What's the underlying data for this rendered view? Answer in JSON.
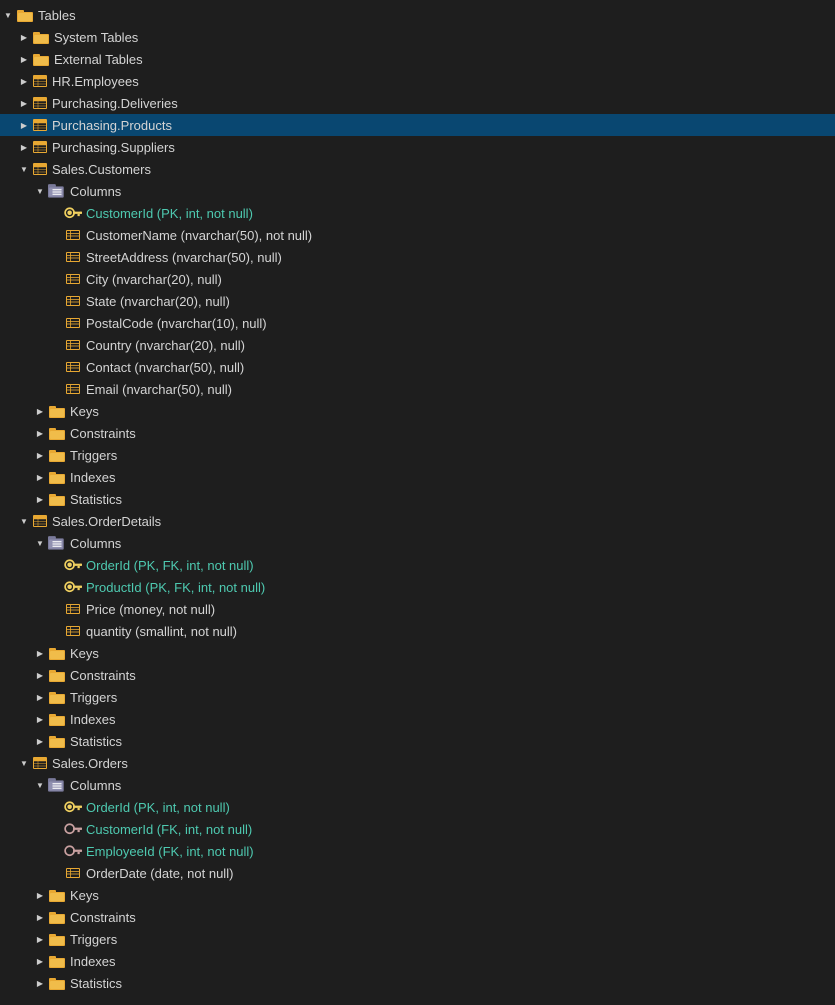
{
  "tree": {
    "items": [
      {
        "id": "tables",
        "label": "Tables",
        "level": 0,
        "toggle": "collapse",
        "icon": "folder",
        "selected": false
      },
      {
        "id": "system-tables",
        "label": "System Tables",
        "level": 1,
        "toggle": "expand",
        "icon": "folder",
        "selected": false
      },
      {
        "id": "external-tables",
        "label": "External Tables",
        "level": 1,
        "toggle": "expand",
        "icon": "folder",
        "selected": false
      },
      {
        "id": "hr-employees",
        "label": "HR.Employees",
        "level": 1,
        "toggle": "expand",
        "icon": "table",
        "selected": false
      },
      {
        "id": "purchasing-deliveries",
        "label": "Purchasing.Deliveries",
        "level": 1,
        "toggle": "expand",
        "icon": "table",
        "selected": false
      },
      {
        "id": "purchasing-products",
        "label": "Purchasing.Products",
        "level": 1,
        "toggle": "expand",
        "icon": "table",
        "selected": true
      },
      {
        "id": "purchasing-suppliers",
        "label": "Purchasing.Suppliers",
        "level": 1,
        "toggle": "expand",
        "icon": "table",
        "selected": false
      },
      {
        "id": "sales-customers",
        "label": "Sales.Customers",
        "level": 1,
        "toggle": "collapse",
        "icon": "table",
        "selected": false
      },
      {
        "id": "sales-customers-columns",
        "label": "Columns",
        "level": 2,
        "toggle": "collapse",
        "icon": "columns-folder",
        "selected": false
      },
      {
        "id": "col-customerid",
        "label": "CustomerId (PK, int, not null)",
        "level": 3,
        "toggle": "none",
        "icon": "pk",
        "selected": false,
        "labelColor": "highlight"
      },
      {
        "id": "col-customername",
        "label": "CustomerName (nvarchar(50), not null)",
        "level": 3,
        "toggle": "none",
        "icon": "column",
        "selected": false
      },
      {
        "id": "col-streetaddress",
        "label": "StreetAddress (nvarchar(50), null)",
        "level": 3,
        "toggle": "none",
        "icon": "column",
        "selected": false
      },
      {
        "id": "col-city",
        "label": "City (nvarchar(20), null)",
        "level": 3,
        "toggle": "none",
        "icon": "column",
        "selected": false
      },
      {
        "id": "col-state",
        "label": "State (nvarchar(20), null)",
        "level": 3,
        "toggle": "none",
        "icon": "column",
        "selected": false
      },
      {
        "id": "col-postalcode",
        "label": "PostalCode (nvarchar(10), null)",
        "level": 3,
        "toggle": "none",
        "icon": "column",
        "selected": false
      },
      {
        "id": "col-country",
        "label": "Country (nvarchar(20), null)",
        "level": 3,
        "toggle": "none",
        "icon": "column",
        "selected": false
      },
      {
        "id": "col-contact",
        "label": "Contact (nvarchar(50), null)",
        "level": 3,
        "toggle": "none",
        "icon": "column",
        "selected": false
      },
      {
        "id": "col-email",
        "label": "Email (nvarchar(50), null)",
        "level": 3,
        "toggle": "none",
        "icon": "column",
        "selected": false
      },
      {
        "id": "sales-customers-keys",
        "label": "Keys",
        "level": 2,
        "toggle": "expand",
        "icon": "folder",
        "selected": false
      },
      {
        "id": "sales-customers-constraints",
        "label": "Constraints",
        "level": 2,
        "toggle": "expand",
        "icon": "folder",
        "selected": false
      },
      {
        "id": "sales-customers-triggers",
        "label": "Triggers",
        "level": 2,
        "toggle": "expand",
        "icon": "folder",
        "selected": false
      },
      {
        "id": "sales-customers-indexes",
        "label": "Indexes",
        "level": 2,
        "toggle": "expand",
        "icon": "folder",
        "selected": false
      },
      {
        "id": "sales-customers-statistics",
        "label": "Statistics",
        "level": 2,
        "toggle": "expand",
        "icon": "folder",
        "selected": false
      },
      {
        "id": "sales-orderdetails",
        "label": "Sales.OrderDetails",
        "level": 1,
        "toggle": "collapse",
        "icon": "table",
        "selected": false
      },
      {
        "id": "sales-orderdetails-columns",
        "label": "Columns",
        "level": 2,
        "toggle": "collapse",
        "icon": "columns-folder",
        "selected": false
      },
      {
        "id": "col-orderid-od",
        "label": "OrderId (PK, FK, int, not null)",
        "level": 3,
        "toggle": "none",
        "icon": "pkfk",
        "selected": false,
        "labelColor": "highlight"
      },
      {
        "id": "col-productid-od",
        "label": "ProductId (PK, FK, int, not null)",
        "level": 3,
        "toggle": "none",
        "icon": "pkfk",
        "selected": false,
        "labelColor": "highlight"
      },
      {
        "id": "col-price-od",
        "label": "Price (money, not null)",
        "level": 3,
        "toggle": "none",
        "icon": "column",
        "selected": false
      },
      {
        "id": "col-quantity-od",
        "label": "quantity (smallint, not null)",
        "level": 3,
        "toggle": "none",
        "icon": "column",
        "selected": false
      },
      {
        "id": "sales-orderdetails-keys",
        "label": "Keys",
        "level": 2,
        "toggle": "expand",
        "icon": "folder",
        "selected": false
      },
      {
        "id": "sales-orderdetails-constraints",
        "label": "Constraints",
        "level": 2,
        "toggle": "expand",
        "icon": "folder",
        "selected": false
      },
      {
        "id": "sales-orderdetails-triggers",
        "label": "Triggers",
        "level": 2,
        "toggle": "expand",
        "icon": "folder",
        "selected": false
      },
      {
        "id": "sales-orderdetails-indexes",
        "label": "Indexes",
        "level": 2,
        "toggle": "expand",
        "icon": "folder",
        "selected": false
      },
      {
        "id": "sales-orderdetails-statistics",
        "label": "Statistics",
        "level": 2,
        "toggle": "expand",
        "icon": "folder",
        "selected": false
      },
      {
        "id": "sales-orders",
        "label": "Sales.Orders",
        "level": 1,
        "toggle": "collapse",
        "icon": "table",
        "selected": false
      },
      {
        "id": "sales-orders-columns",
        "label": "Columns",
        "level": 2,
        "toggle": "collapse",
        "icon": "columns-folder",
        "selected": false
      },
      {
        "id": "col-orderid-o",
        "label": "OrderId (PK, int, not null)",
        "level": 3,
        "toggle": "none",
        "icon": "pk",
        "selected": false,
        "labelColor": "highlight"
      },
      {
        "id": "col-customerid-o",
        "label": "CustomerId (FK, int, not null)",
        "level": 3,
        "toggle": "none",
        "icon": "fk",
        "selected": false,
        "labelColor": "highlight"
      },
      {
        "id": "col-employeeid-o",
        "label": "EmployeeId (FK, int, not null)",
        "level": 3,
        "toggle": "none",
        "icon": "fk",
        "selected": false,
        "labelColor": "highlight"
      },
      {
        "id": "col-orderdate-o",
        "label": "OrderDate (date, not null)",
        "level": 3,
        "toggle": "none",
        "icon": "column",
        "selected": false
      },
      {
        "id": "sales-orders-keys",
        "label": "Keys",
        "level": 2,
        "toggle": "expand",
        "icon": "folder",
        "selected": false
      },
      {
        "id": "sales-orders-constraints",
        "label": "Constraints",
        "level": 2,
        "toggle": "expand",
        "icon": "folder",
        "selected": false
      },
      {
        "id": "sales-orders-triggers",
        "label": "Triggers",
        "level": 2,
        "toggle": "expand",
        "icon": "folder",
        "selected": false
      },
      {
        "id": "sales-orders-indexes",
        "label": "Indexes",
        "level": 2,
        "toggle": "expand",
        "icon": "folder",
        "selected": false
      },
      {
        "id": "sales-orders-statistics",
        "label": "Statistics",
        "level": 2,
        "toggle": "expand",
        "icon": "folder",
        "selected": false
      }
    ]
  },
  "colors": {
    "background": "#1e1e1e",
    "selected": "#094771",
    "text": "#d4d4d4",
    "highlight": "#4ec9b0",
    "folder_orange": "#e8a832",
    "table_orange": "#e8a832",
    "toggle_arrow": "#cccccc"
  }
}
